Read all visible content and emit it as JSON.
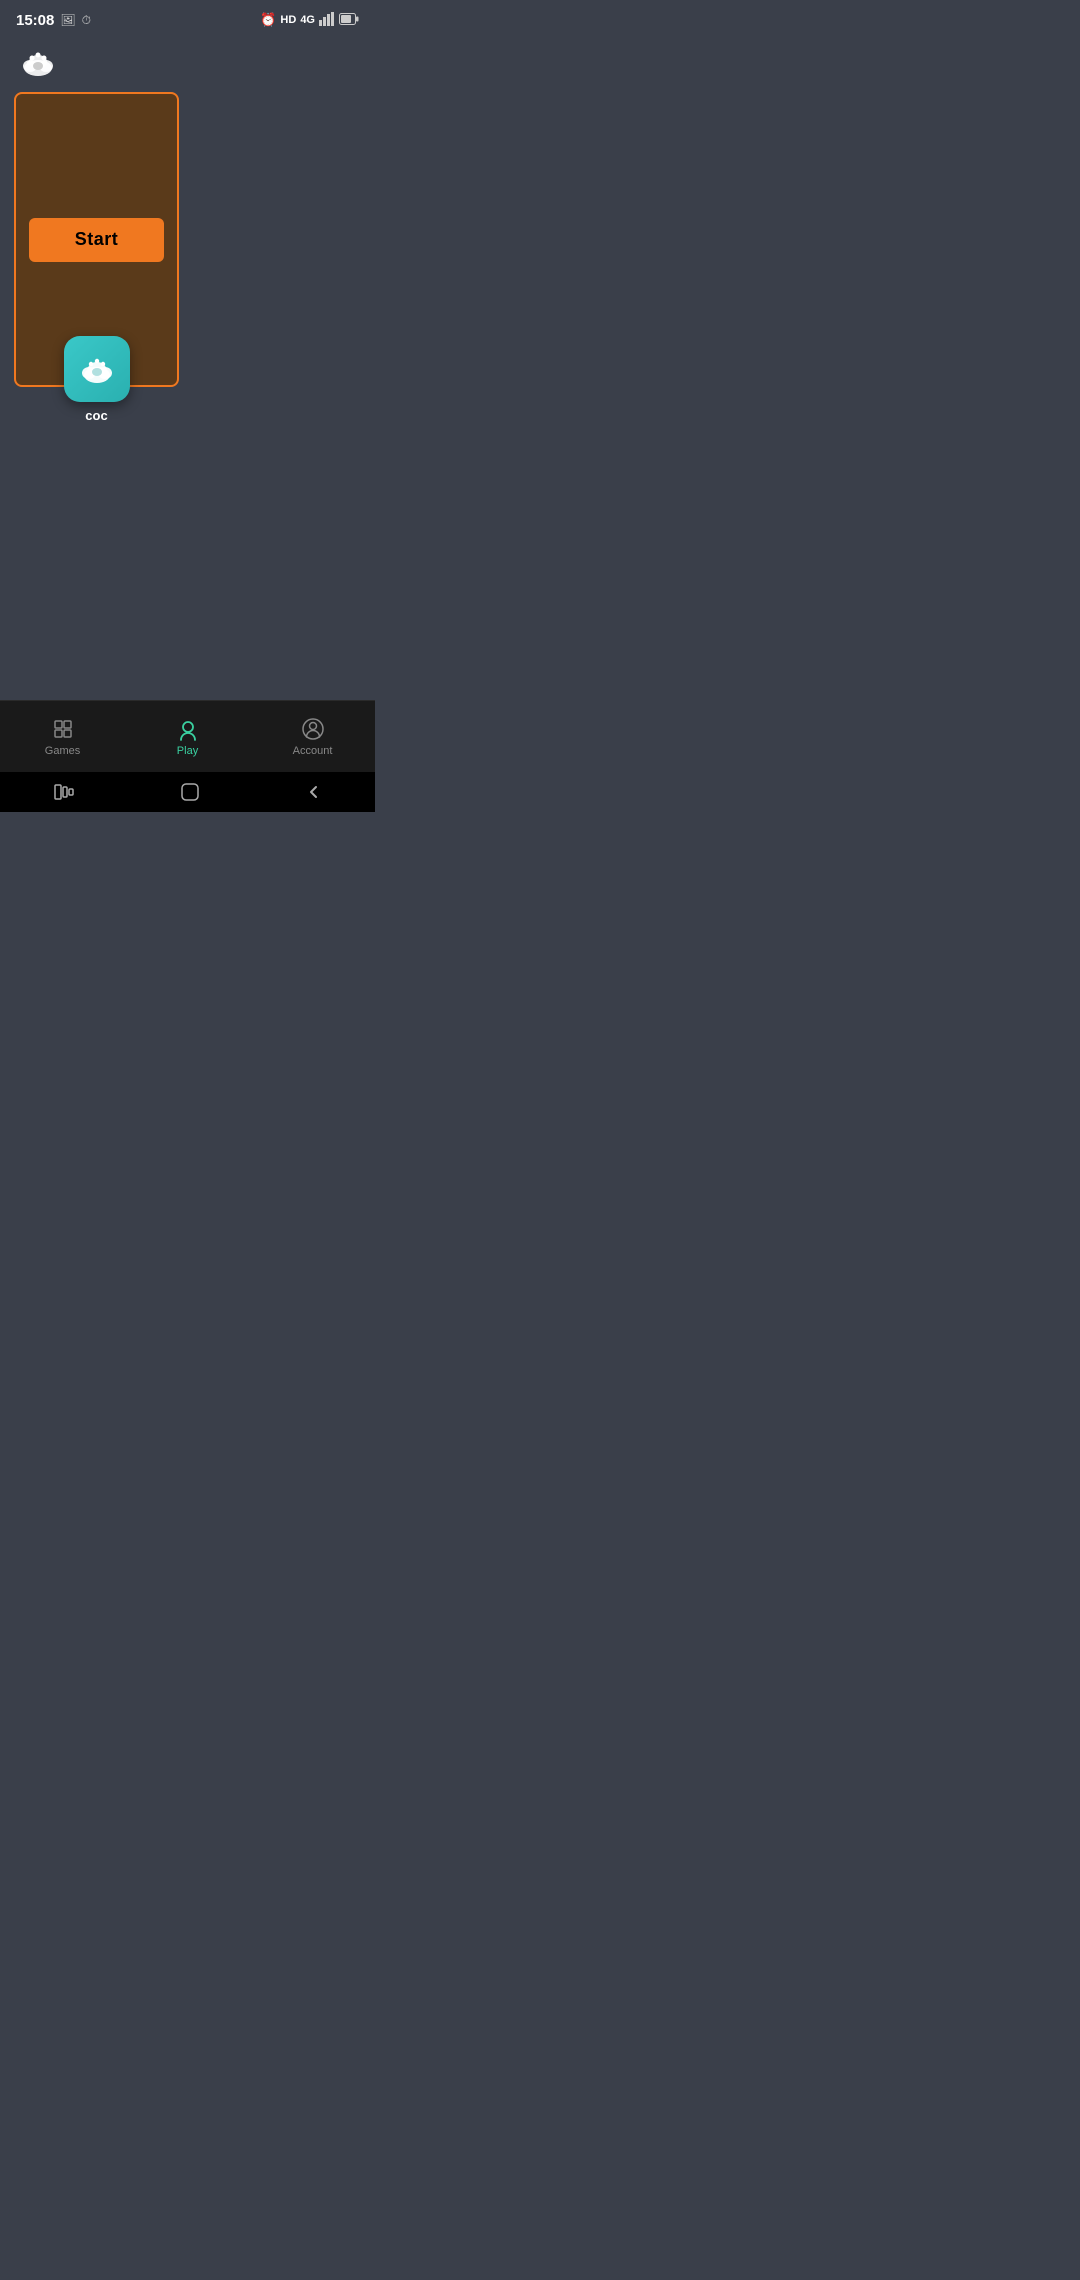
{
  "status_bar": {
    "time": "15:08",
    "left_icons": [
      "image",
      "clock"
    ],
    "right_icons": [
      "alarm",
      "HD",
      "4G",
      "signal",
      "battery"
    ]
  },
  "app": {
    "name": "coc",
    "brand_color": "#f07820",
    "bg_color": "#3a3f4a"
  },
  "game_card": {
    "start_button_label": "Start",
    "border_color": "#f07820",
    "bg_color": "#5a3a1a"
  },
  "nav": {
    "items": [
      {
        "id": "games",
        "label": "Games",
        "active": false
      },
      {
        "id": "play",
        "label": "Play",
        "active": true
      },
      {
        "id": "account",
        "label": "Account",
        "active": false
      }
    ]
  },
  "gesture_bar": {
    "items": [
      "menu",
      "home",
      "back"
    ]
  }
}
